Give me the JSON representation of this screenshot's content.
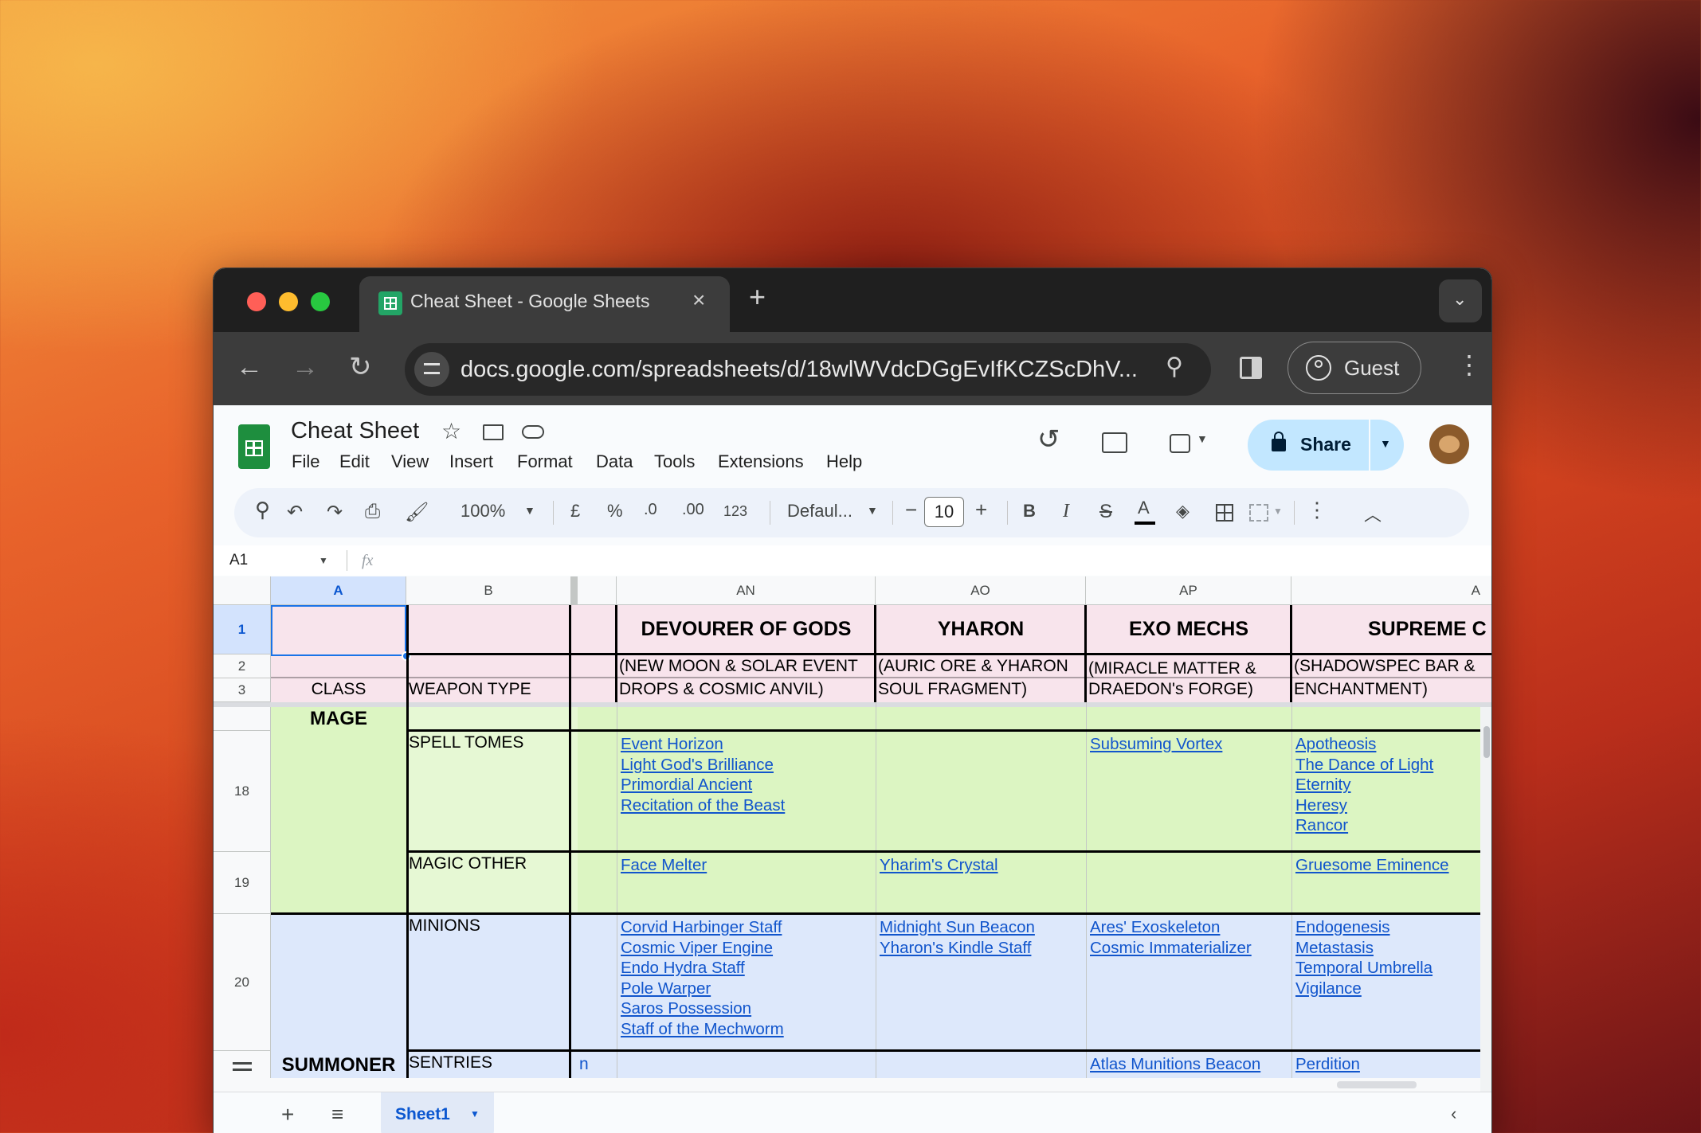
{
  "browser": {
    "tab_title": "Cheat Sheet - Google Sheets",
    "url": "docs.google.com/spreadsheets/d/18wlWVdcDGgEvIfKCZScDhV...",
    "profile": "Guest"
  },
  "doc": {
    "title": "Cheat Sheet",
    "menus": [
      "File",
      "Edit",
      "View",
      "Insert",
      "Format",
      "Data",
      "Tools",
      "Extensions",
      "Help"
    ],
    "share_label": "Share"
  },
  "toolbar": {
    "zoom": "100%",
    "currency": "£",
    "percent": "%",
    "dec_decrease": ".0",
    "dec_increase": ".00",
    "number_format": "123",
    "font": "Defaul...",
    "font_size": "10",
    "bold": "B",
    "italic": "I",
    "text_color": "A"
  },
  "formula": {
    "cell_ref": "A1",
    "fx": "fx"
  },
  "columns": {
    "a": "A",
    "b": "B",
    "an": "AN",
    "ao": "AO",
    "ap": "AP",
    "aq": "A"
  },
  "rows": {
    "r1": "1",
    "r2": "2",
    "r3": "3",
    "r18": "18",
    "r19": "19",
    "r20": "20"
  },
  "header": {
    "class_label": "CLASS",
    "weapon_type_label": "WEAPON TYPE",
    "bosses": [
      {
        "name": "DEVOURER OF GODS",
        "line1": "(NEW MOON & SOLAR EVENT",
        "line2": "DROPS & COSMIC ANVIL)"
      },
      {
        "name": "YHARON",
        "line1": "(AURIC ORE & YHARON",
        "line2": "SOUL FRAGMENT)"
      },
      {
        "name": "EXO MECHS",
        "line1": "(MIRACLE MATTER &",
        "line2": "DRAEDON's FORGE)"
      },
      {
        "name": "SUPREME C",
        "line1": "(SHADOWSPEC BAR &",
        "line2": "ENCHANTMENT)"
      }
    ]
  },
  "body": {
    "mage": "MAGE",
    "summoner": "SUMMONER",
    "spell_tomes": "SPELL TOMES",
    "magic_other": "MAGIC OTHER",
    "minions": "MINIONS",
    "sentries": "SENTRIES",
    "sentries_frag": "n",
    "spell_tomes_links": [
      [
        "Event Horizon",
        "Light God's Brilliance",
        "Primordial Ancient",
        "Recitation of the Beast"
      ],
      [],
      [
        "Subsuming Vortex"
      ],
      [
        "Apotheosis",
        "The Dance of Light",
        "Eternity",
        "Heresy",
        "Rancor"
      ]
    ],
    "magic_other_links": [
      [
        "Face Melter"
      ],
      [
        "Yharim's Crystal"
      ],
      [],
      [
        "Gruesome Eminence"
      ]
    ],
    "minions_links": [
      [
        "Corvid Harbinger Staff",
        "Cosmic Viper Engine",
        "Endo Hydra Staff",
        "Pole Warper",
        "Saros Possession",
        "Staff of the Mechworm"
      ],
      [
        "Midnight Sun Beacon",
        "Yharon's Kindle Staff"
      ],
      [
        "Ares' Exoskeleton",
        "Cosmic Immaterializer"
      ],
      [
        "Endogenesis",
        "Metastasis",
        "Temporal Umbrella",
        "Vigilance"
      ]
    ],
    "sentries_links": [
      [],
      [],
      [
        "Atlas Munitions Beacon"
      ],
      [
        "Perdition"
      ]
    ]
  },
  "sheet_tab": "Sheet1",
  "colors": {
    "pink": "#f8e4ec",
    "green": "#dcf5c2",
    "green_light": "#e6f8d4",
    "blue": "#dde8fb",
    "link": "#1155cc",
    "share_bg": "#c2e7ff"
  }
}
